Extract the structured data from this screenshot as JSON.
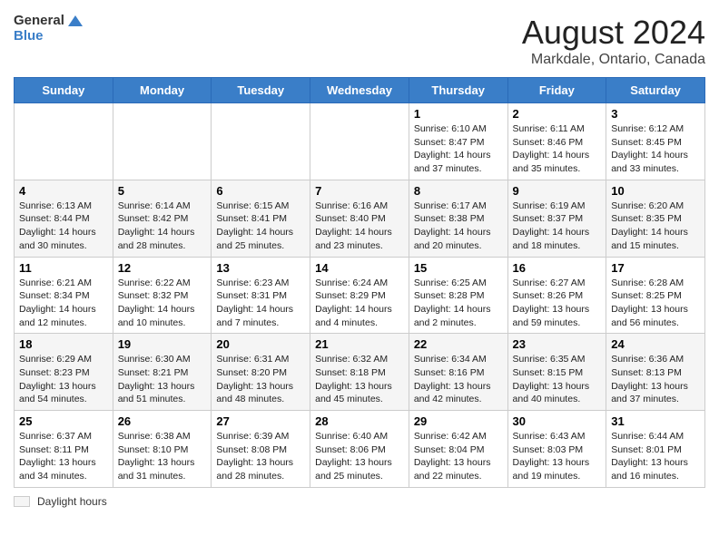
{
  "header": {
    "logo_line1": "General",
    "logo_line2": "Blue",
    "title": "August 2024",
    "subtitle": "Markdale, Ontario, Canada"
  },
  "days_of_week": [
    "Sunday",
    "Monday",
    "Tuesday",
    "Wednesday",
    "Thursday",
    "Friday",
    "Saturday"
  ],
  "legend": {
    "label": "Daylight hours"
  },
  "weeks": [
    [
      {
        "day": "",
        "sunrise": "",
        "sunset": "",
        "daylight": ""
      },
      {
        "day": "",
        "sunrise": "",
        "sunset": "",
        "daylight": ""
      },
      {
        "day": "",
        "sunrise": "",
        "sunset": "",
        "daylight": ""
      },
      {
        "day": "",
        "sunrise": "",
        "sunset": "",
        "daylight": ""
      },
      {
        "day": "1",
        "sunrise": "Sunrise: 6:10 AM",
        "sunset": "Sunset: 8:47 PM",
        "daylight": "Daylight: 14 hours and 37 minutes."
      },
      {
        "day": "2",
        "sunrise": "Sunrise: 6:11 AM",
        "sunset": "Sunset: 8:46 PM",
        "daylight": "Daylight: 14 hours and 35 minutes."
      },
      {
        "day": "3",
        "sunrise": "Sunrise: 6:12 AM",
        "sunset": "Sunset: 8:45 PM",
        "daylight": "Daylight: 14 hours and 33 minutes."
      }
    ],
    [
      {
        "day": "4",
        "sunrise": "Sunrise: 6:13 AM",
        "sunset": "Sunset: 8:44 PM",
        "daylight": "Daylight: 14 hours and 30 minutes."
      },
      {
        "day": "5",
        "sunrise": "Sunrise: 6:14 AM",
        "sunset": "Sunset: 8:42 PM",
        "daylight": "Daylight: 14 hours and 28 minutes."
      },
      {
        "day": "6",
        "sunrise": "Sunrise: 6:15 AM",
        "sunset": "Sunset: 8:41 PM",
        "daylight": "Daylight: 14 hours and 25 minutes."
      },
      {
        "day": "7",
        "sunrise": "Sunrise: 6:16 AM",
        "sunset": "Sunset: 8:40 PM",
        "daylight": "Daylight: 14 hours and 23 minutes."
      },
      {
        "day": "8",
        "sunrise": "Sunrise: 6:17 AM",
        "sunset": "Sunset: 8:38 PM",
        "daylight": "Daylight: 14 hours and 20 minutes."
      },
      {
        "day": "9",
        "sunrise": "Sunrise: 6:19 AM",
        "sunset": "Sunset: 8:37 PM",
        "daylight": "Daylight: 14 hours and 18 minutes."
      },
      {
        "day": "10",
        "sunrise": "Sunrise: 6:20 AM",
        "sunset": "Sunset: 8:35 PM",
        "daylight": "Daylight: 14 hours and 15 minutes."
      }
    ],
    [
      {
        "day": "11",
        "sunrise": "Sunrise: 6:21 AM",
        "sunset": "Sunset: 8:34 PM",
        "daylight": "Daylight: 14 hours and 12 minutes."
      },
      {
        "day": "12",
        "sunrise": "Sunrise: 6:22 AM",
        "sunset": "Sunset: 8:32 PM",
        "daylight": "Daylight: 14 hours and 10 minutes."
      },
      {
        "day": "13",
        "sunrise": "Sunrise: 6:23 AM",
        "sunset": "Sunset: 8:31 PM",
        "daylight": "Daylight: 14 hours and 7 minutes."
      },
      {
        "day": "14",
        "sunrise": "Sunrise: 6:24 AM",
        "sunset": "Sunset: 8:29 PM",
        "daylight": "Daylight: 14 hours and 4 minutes."
      },
      {
        "day": "15",
        "sunrise": "Sunrise: 6:25 AM",
        "sunset": "Sunset: 8:28 PM",
        "daylight": "Daylight: 14 hours and 2 minutes."
      },
      {
        "day": "16",
        "sunrise": "Sunrise: 6:27 AM",
        "sunset": "Sunset: 8:26 PM",
        "daylight": "Daylight: 13 hours and 59 minutes."
      },
      {
        "day": "17",
        "sunrise": "Sunrise: 6:28 AM",
        "sunset": "Sunset: 8:25 PM",
        "daylight": "Daylight: 13 hours and 56 minutes."
      }
    ],
    [
      {
        "day": "18",
        "sunrise": "Sunrise: 6:29 AM",
        "sunset": "Sunset: 8:23 PM",
        "daylight": "Daylight: 13 hours and 54 minutes."
      },
      {
        "day": "19",
        "sunrise": "Sunrise: 6:30 AM",
        "sunset": "Sunset: 8:21 PM",
        "daylight": "Daylight: 13 hours and 51 minutes."
      },
      {
        "day": "20",
        "sunrise": "Sunrise: 6:31 AM",
        "sunset": "Sunset: 8:20 PM",
        "daylight": "Daylight: 13 hours and 48 minutes."
      },
      {
        "day": "21",
        "sunrise": "Sunrise: 6:32 AM",
        "sunset": "Sunset: 8:18 PM",
        "daylight": "Daylight: 13 hours and 45 minutes."
      },
      {
        "day": "22",
        "sunrise": "Sunrise: 6:34 AM",
        "sunset": "Sunset: 8:16 PM",
        "daylight": "Daylight: 13 hours and 42 minutes."
      },
      {
        "day": "23",
        "sunrise": "Sunrise: 6:35 AM",
        "sunset": "Sunset: 8:15 PM",
        "daylight": "Daylight: 13 hours and 40 minutes."
      },
      {
        "day": "24",
        "sunrise": "Sunrise: 6:36 AM",
        "sunset": "Sunset: 8:13 PM",
        "daylight": "Daylight: 13 hours and 37 minutes."
      }
    ],
    [
      {
        "day": "25",
        "sunrise": "Sunrise: 6:37 AM",
        "sunset": "Sunset: 8:11 PM",
        "daylight": "Daylight: 13 hours and 34 minutes."
      },
      {
        "day": "26",
        "sunrise": "Sunrise: 6:38 AM",
        "sunset": "Sunset: 8:10 PM",
        "daylight": "Daylight: 13 hours and 31 minutes."
      },
      {
        "day": "27",
        "sunrise": "Sunrise: 6:39 AM",
        "sunset": "Sunset: 8:08 PM",
        "daylight": "Daylight: 13 hours and 28 minutes."
      },
      {
        "day": "28",
        "sunrise": "Sunrise: 6:40 AM",
        "sunset": "Sunset: 8:06 PM",
        "daylight": "Daylight: 13 hours and 25 minutes."
      },
      {
        "day": "29",
        "sunrise": "Sunrise: 6:42 AM",
        "sunset": "Sunset: 8:04 PM",
        "daylight": "Daylight: 13 hours and 22 minutes."
      },
      {
        "day": "30",
        "sunrise": "Sunrise: 6:43 AM",
        "sunset": "Sunset: 8:03 PM",
        "daylight": "Daylight: 13 hours and 19 minutes."
      },
      {
        "day": "31",
        "sunrise": "Sunrise: 6:44 AM",
        "sunset": "Sunset: 8:01 PM",
        "daylight": "Daylight: 13 hours and 16 minutes."
      }
    ]
  ]
}
